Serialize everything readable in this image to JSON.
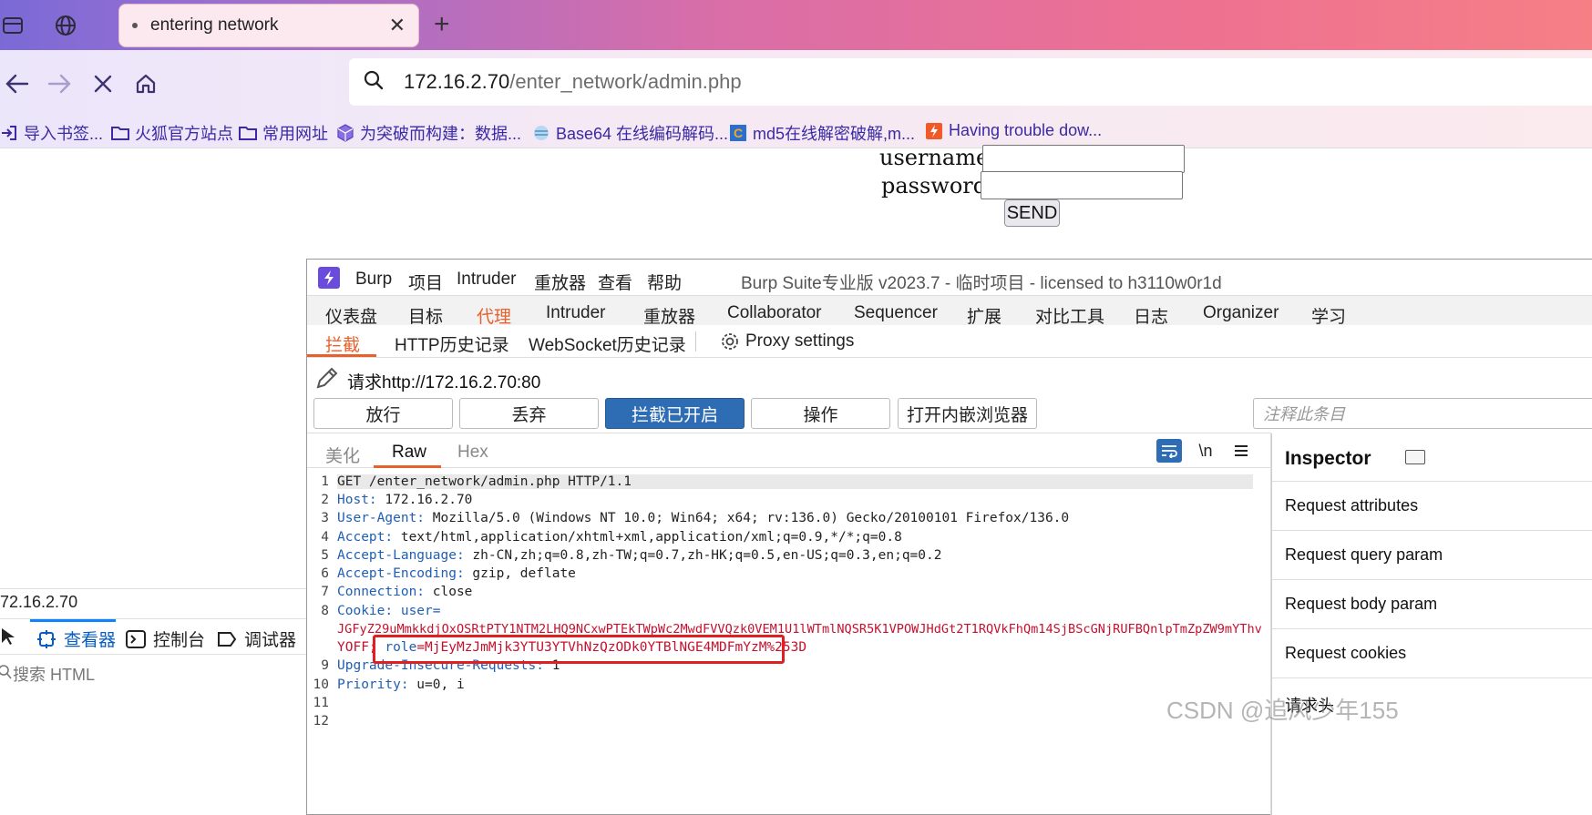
{
  "browser": {
    "tab_title": "entering network",
    "url_host": "172.16.2.70",
    "url_path": "/enter_network/admin.php",
    "bookmarks": [
      "导入书签...",
      "火狐官方站点",
      "常用网址",
      "为突破而构建：数据...",
      "Base64 在线编码解码...",
      "md5在线解密破解,m...",
      "Having trouble dow..."
    ]
  },
  "page": {
    "username_label": "username:",
    "password_label": "password:",
    "send_label": "SEND"
  },
  "devtools": {
    "url": "72.16.2.70",
    "tabs": [
      "查看器",
      "控制台",
      "调试器"
    ],
    "search_placeholder": "搜索 HTML"
  },
  "burp": {
    "menu": [
      "Burp",
      "项目",
      "Intruder",
      "重放器",
      "查看",
      "帮助"
    ],
    "window_title": "Burp Suite专业版  v2023.7 - 临时项目 - licensed to h3110w0r1d",
    "tabs": [
      "仪表盘",
      "目标",
      "代理",
      "Intruder",
      "重放器",
      "Collaborator",
      "Sequencer",
      "扩展",
      "对比工具",
      "日志",
      "Organizer",
      "学习"
    ],
    "active_tab": "代理",
    "subtabs": [
      "拦截",
      "HTTP历史记录",
      "WebSocket历史记录",
      "Proxy settings"
    ],
    "request_label": "请求http://172.16.2.70:80",
    "buttons": [
      "放行",
      "丢弃",
      "拦截已开启",
      "操作",
      "打开内嵌浏览器"
    ],
    "note_placeholder": "注释此条目",
    "editor_tabs": [
      "美化",
      "Raw",
      "Hex"
    ],
    "editor_icons": [
      "wrap-icon",
      "\\n",
      "menu-icon"
    ],
    "code_lines": [
      {
        "n": "1",
        "key": "",
        "val": "GET /enter_network/admin.php HTTP/1.1"
      },
      {
        "n": "2",
        "key": "Host:",
        "val": " 172.16.2.70"
      },
      {
        "n": "3",
        "key": "User-Agent:",
        "val": " Mozilla/5.0 (Windows NT 10.0; Win64; x64; rv:136.0) Gecko/20100101 Firefox/136.0"
      },
      {
        "n": "4",
        "key": "Accept:",
        "val": " text/html,application/xhtml+xml,application/xml;q=0.9,*/*;q=0.8"
      },
      {
        "n": "5",
        "key": "Accept-Language:",
        "val": " zh-CN,zh;q=0.8,zh-TW;q=0.7,zh-HK;q=0.5,en-US;q=0.3,en;q=0.2"
      },
      {
        "n": "6",
        "key": "Accept-Encoding:",
        "val": " gzip, deflate"
      },
      {
        "n": "7",
        "key": "Connection:",
        "val": " close"
      },
      {
        "n": "8",
        "key": "Cookie:",
        "val": " user="
      },
      {
        "n": "",
        "key": "",
        "val": "JGFyZ29uMmkkdjOxOSRtPTY1NTM2LHQ9NCxwPTEkTWpWc2MwdFVVQzk0VEM1U1lWTmlNQSR5K1VPOWJHdGt2T1RQVkFhQm14SjBScGNjRUFBQnlpTmZpZW9mYThv"
      },
      {
        "n": "",
        "key": "",
        "val": "YOFF;"
      },
      {
        "n": "9",
        "key": "Upgrade-Insecure-Requests:",
        "val": " 1"
      },
      {
        "n": "10",
        "key": "Priority:",
        "val": " u=0, i"
      },
      {
        "n": "11",
        "key": "",
        "val": ""
      },
      {
        "n": "12",
        "key": "",
        "val": ""
      }
    ],
    "cookie_role_key": "role",
    "cookie_role_val": "=MjEyMzJmMjk3YTU3YTVhNzQzODk0YTBlNGE4MDFmYzM%253D",
    "inspector": {
      "title": "Inspector",
      "items": [
        "Request attributes",
        "Request query param",
        "Request body param",
        "Request cookies",
        "请求头"
      ]
    }
  },
  "watermark": "CSDN @追风少年155"
}
